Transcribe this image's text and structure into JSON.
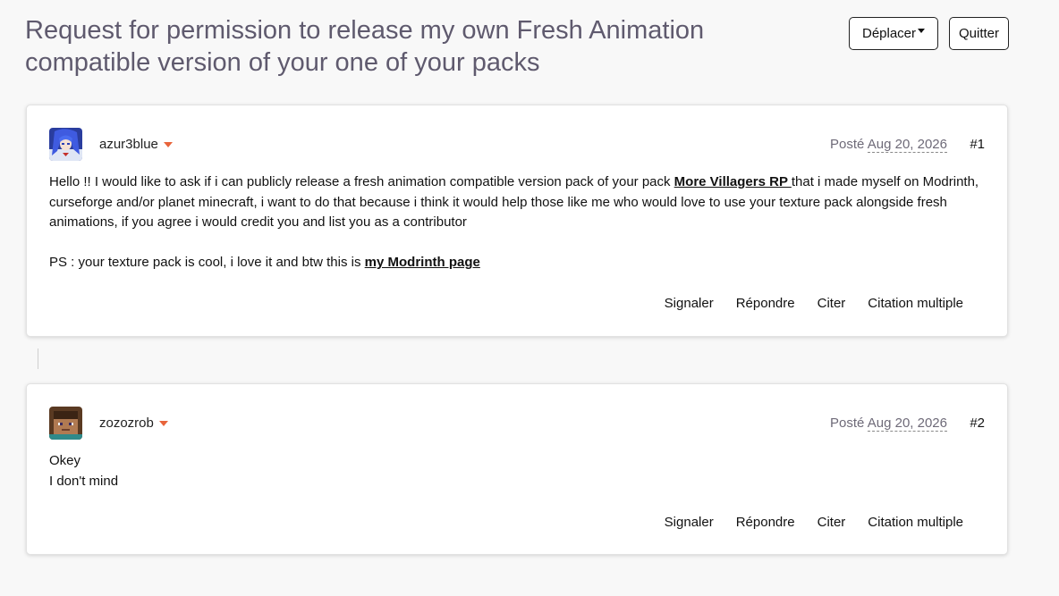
{
  "topic": {
    "title": "Request for permission to release my own Fresh Animation compatible version of your one of your packs"
  },
  "header_actions": {
    "move_label": "Déplacer",
    "quit_label": "Quitter"
  },
  "posts": [
    {
      "author": "azur3blue",
      "posted_label": "Posté",
      "date": "Aug 20, 2026",
      "number": "#1",
      "body": {
        "p1_before": "Hello !! I would like to ask if i can publicly release a fresh animation compatible version pack of your pack ",
        "p1_link": "More Villagers RP ",
        "p1_after": "that i made myself on Modrinth, curseforge and/or planet minecraft, i want to do that because i think it would help those like me who would love to use your texture pack alongside fresh animations, if you agree i would credit you and list you as a contributor",
        "p2_before": "PS : your texture pack is cool, i love it and btw this is ",
        "p2_link": "my Modrinth page "
      },
      "actions": {
        "report": "Signaler",
        "reply": "Répondre",
        "quote": "Citer",
        "multi_quote": "Citation multiple"
      }
    },
    {
      "author": "zozozrob",
      "posted_label": "Posté",
      "date": "Aug 20, 2026",
      "number": "#2",
      "body": {
        "line1": "Okey",
        "line2": "I don't mind"
      },
      "actions": {
        "report": "Signaler",
        "reply": "Répondre",
        "quote": "Citer",
        "multi_quote": "Citation multiple"
      }
    }
  ],
  "colors": {
    "title": "#5f5a6e",
    "accent_caret": "#e8643b",
    "meta": "#6e6a78",
    "background": "#f8f8f8"
  },
  "icons": {
    "dropdown": "caret-down-icon",
    "author_menu": "author-caret-icon"
  }
}
